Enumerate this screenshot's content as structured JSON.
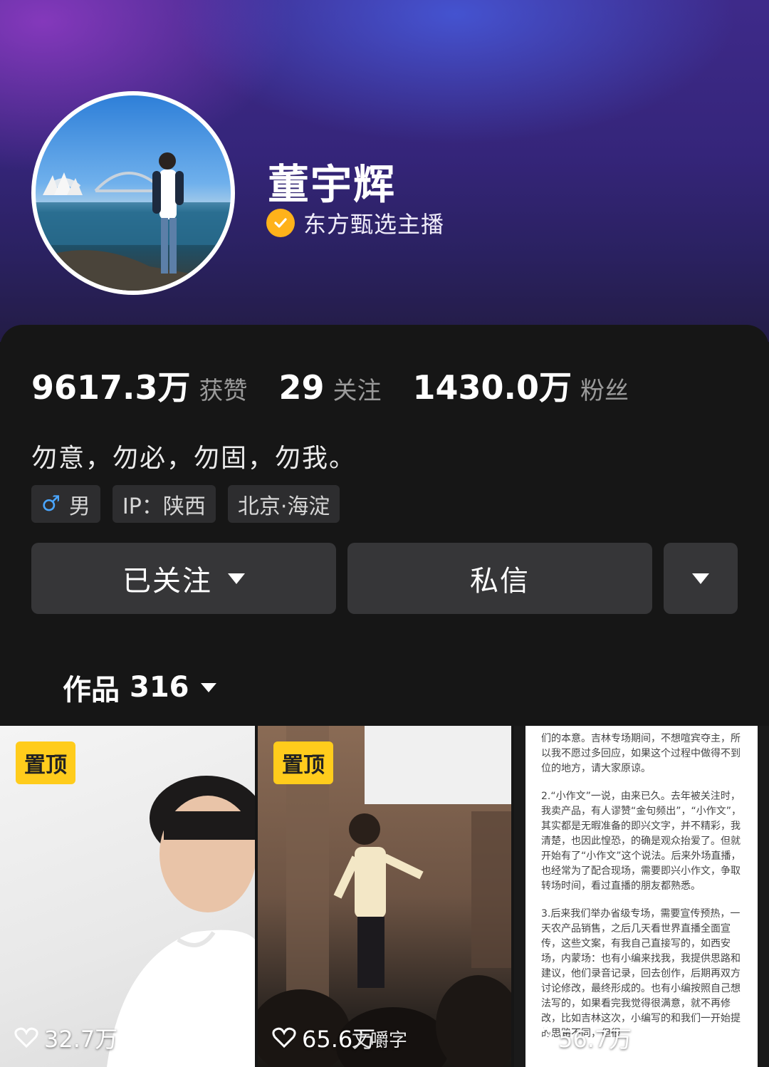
{
  "profile": {
    "name": "董宇辉",
    "verification": "东方甄选主播"
  },
  "stats": [
    {
      "value": "9617.3万",
      "label": "获赞"
    },
    {
      "value": "29",
      "label": "关注"
    },
    {
      "value": "1430.0万",
      "label": "粉丝"
    }
  ],
  "bio": "勿意，勿必，勿固，勿我。",
  "tags": {
    "gender_symbol": "♂",
    "gender": "男",
    "ip": "IP：陕西",
    "location": "北京·海淀"
  },
  "actions": {
    "follow_label": "已关注",
    "message_label": "私信"
  },
  "works_tab": {
    "label": "作品",
    "count": "316"
  },
  "videos": [
    {
      "pin_label": "置顶",
      "likes": "32.7万"
    },
    {
      "pin_label": "置顶",
      "likes": "65.6万"
    },
    {
      "likes": "56.7万"
    }
  ],
  "doc_text": {
    "p1": "们的本意。吉林专场期间，不想喧宾夺主，所以我不愿过多回应，如果这个过程中做得不到位的地方，请大家原谅。",
    "p2": "2.“小作文”一说，由来已久。去年被关注时，我卖产品，有人谬赞“金句频出”，“小作文”，其实都是无暇准备的即兴文字，并不精彩，我清楚，也因此惶恐，的确是观众抬爱了。但就开始有了“小作文”这个说法。后来外场直播，也经常为了配合现场，需要即兴小作文，争取转场时间，看过直播的朋友都熟悉。",
    "p3": "3.后来我们举办省级专场，需要宣传预热，一天农产品销售，之后几天看世界直播全面宣传，这些文案，有我自己直接写的，如西安场，内蒙场：也有小编来找我，我提供思路和建议，他们录音记录，回去创作，后期再双方讨论修改，最终形成的。也有小编按照自己想法写的，如果看完我觉得很满意，就不再修改，比如吉林这次，小编写的和我们一开始提的思路不同，但很"
  },
  "watermark": "文嚼字"
}
